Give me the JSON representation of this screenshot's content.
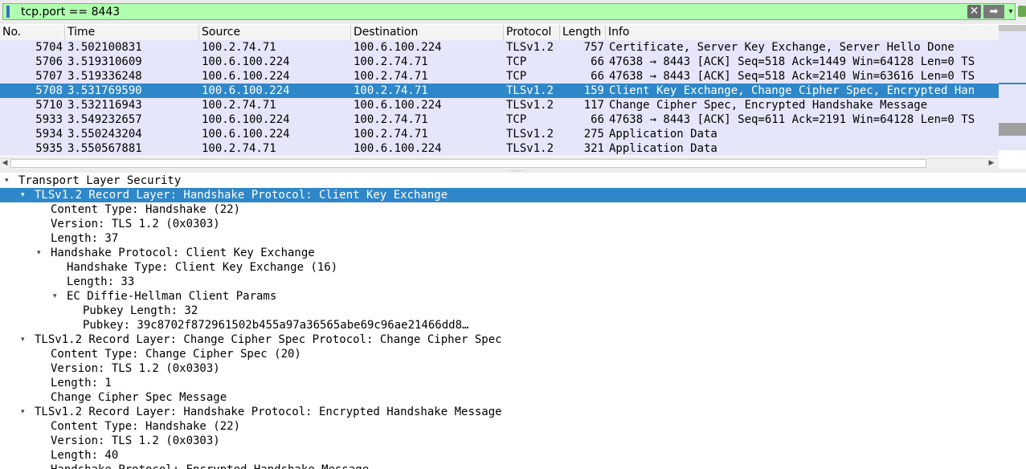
{
  "filter": {
    "value": "tcp.port == 8443",
    "clear_glyph": "✕",
    "apply_glyph": "➡",
    "dropdown_glyph": "▾"
  },
  "columns": {
    "no": "No.",
    "time": "Time",
    "source": "Source",
    "destination": "Destination",
    "protocol": "Protocol",
    "length": "Length",
    "info": "Info"
  },
  "packets": [
    {
      "no": "5704",
      "time": "3.502100831",
      "source": "100.2.74.71",
      "destination": "100.6.100.224",
      "protocol": "TLSv1.2",
      "length": "757",
      "info": "Certificate, Server Key Exchange, Server Hello Done"
    },
    {
      "no": "5706",
      "time": "3.519310609",
      "source": "100.6.100.224",
      "destination": "100.2.74.71",
      "protocol": "TCP",
      "length": "66",
      "info": "47638 → 8443 [ACK] Seq=518 Ack=1449 Win=64128 Len=0 TS"
    },
    {
      "no": "5707",
      "time": "3.519336248",
      "source": "100.6.100.224",
      "destination": "100.2.74.71",
      "protocol": "TCP",
      "length": "66",
      "info": "47638 → 8443 [ACK] Seq=518 Ack=2140 Win=63616 Len=0 TS"
    },
    {
      "no": "5708",
      "time": "3.531769590",
      "source": "100.6.100.224",
      "destination": "100.2.74.71",
      "protocol": "TLSv1.2",
      "length": "159",
      "info": "Client Key Exchange, Change Cipher Spec, Encrypted Han"
    },
    {
      "no": "5710",
      "time": "3.532116943",
      "source": "100.2.74.71",
      "destination": "100.6.100.224",
      "protocol": "TLSv1.2",
      "length": "117",
      "info": "Change Cipher Spec, Encrypted Handshake Message"
    },
    {
      "no": "5933",
      "time": "3.549232657",
      "source": "100.6.100.224",
      "destination": "100.2.74.71",
      "protocol": "TCP",
      "length": "66",
      "info": "47638 → 8443 [ACK] Seq=611 Ack=2191 Win=64128 Len=0 TS"
    },
    {
      "no": "5934",
      "time": "3.550243204",
      "source": "100.6.100.224",
      "destination": "100.2.74.71",
      "protocol": "TLSv1.2",
      "length": "275",
      "info": "Application Data"
    },
    {
      "no": "5935",
      "time": "3.550567881",
      "source": "100.2.74.71",
      "destination": "100.6.100.224",
      "protocol": "TLSv1.2",
      "length": "321",
      "info": "Application Data"
    }
  ],
  "selected_packet_index": 3,
  "details": [
    {
      "text": "Transport Layer Security",
      "level": 0,
      "expander": "expanded"
    },
    {
      "text": "TLSv1.2 Record Layer: Handshake Protocol: Client Key Exchange",
      "level": 1,
      "expander": "expanded",
      "selected": true
    },
    {
      "text": "Content Type: Handshake (22)",
      "level": 2
    },
    {
      "text": "Version: TLS 1.2 (0x0303)",
      "level": 2
    },
    {
      "text": "Length: 37",
      "level": 2
    },
    {
      "text": "Handshake Protocol: Client Key Exchange",
      "level": 2,
      "expander": "expanded"
    },
    {
      "text": "Handshake Type: Client Key Exchange (16)",
      "level": 3
    },
    {
      "text": "Length: 33",
      "level": 3
    },
    {
      "text": "EC Diffie-Hellman Client Params",
      "level": 3,
      "expander": "expanded"
    },
    {
      "text": "Pubkey Length: 32",
      "level": 4
    },
    {
      "text": "Pubkey: 39c8702f872961502b455a97a36565abe69c96ae21466dd8…",
      "level": 4
    },
    {
      "text": "TLSv1.2 Record Layer: Change Cipher Spec Protocol: Change Cipher Spec",
      "level": 1,
      "expander": "expanded"
    },
    {
      "text": "Content Type: Change Cipher Spec (20)",
      "level": 2
    },
    {
      "text": "Version: TLS 1.2 (0x0303)",
      "level": 2
    },
    {
      "text": "Length: 1",
      "level": 2
    },
    {
      "text": "Change Cipher Spec Message",
      "level": 2
    },
    {
      "text": "TLSv1.2 Record Layer: Handshake Protocol: Encrypted Handshake Message",
      "level": 1,
      "expander": "expanded"
    },
    {
      "text": "Content Type: Handshake (22)",
      "level": 2
    },
    {
      "text": "Version: TLS 1.2 (0x0303)",
      "level": 2
    },
    {
      "text": "Length: 40",
      "level": 2
    },
    {
      "text": "Handshake Protocol: Encrypted Handshake Message",
      "level": 2
    }
  ],
  "colors": {
    "row_bg": "#e6e6fa",
    "selected_bg": "#2e87c8",
    "filter_valid_bg": "#afffaf"
  },
  "icons": {
    "bookmark": "bookmark-icon",
    "clear": "clear-filter-icon",
    "apply": "apply-filter-icon",
    "dropdown": "filter-history-icon",
    "add": "add-filter-button-icon",
    "expander_glyph": "▾"
  }
}
